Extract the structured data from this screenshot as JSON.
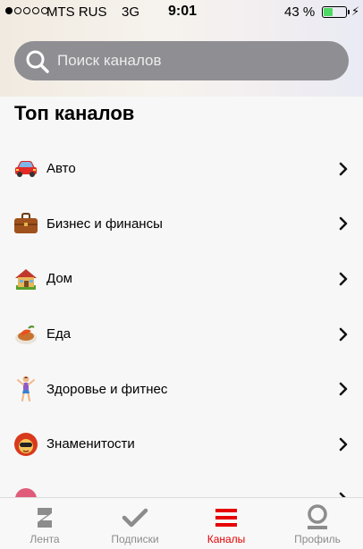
{
  "status_bar": {
    "carrier": "MTS RUS",
    "network": "3G",
    "time": "9:01",
    "battery_percent": "43 %",
    "battery_level": 0.43,
    "signal_bars": 1
  },
  "search": {
    "placeholder": "Поиск каналов"
  },
  "section": {
    "title": "Топ каналов"
  },
  "categories": [
    {
      "label": "Авто",
      "icon": "car-icon"
    },
    {
      "label": "Бизнес и финансы",
      "icon": "briefcase-icon"
    },
    {
      "label": "Дом",
      "icon": "house-icon"
    },
    {
      "label": "Еда",
      "icon": "food-icon"
    },
    {
      "label": "Здоровье и фитнес",
      "icon": "fitness-icon"
    },
    {
      "label": "Знаменитости",
      "icon": "celebrity-icon"
    }
  ],
  "tabbar": {
    "tabs": [
      {
        "label": "Лента",
        "icon": "feed-icon",
        "active": false
      },
      {
        "label": "Подписки",
        "icon": "checkmark-icon",
        "active": false
      },
      {
        "label": "Каналы",
        "icon": "menu-icon",
        "active": true
      },
      {
        "label": "Профиль",
        "icon": "profile-icon",
        "active": false
      }
    ]
  },
  "colors": {
    "accent": "#e60000",
    "search_bg": "#8e8e93",
    "battery": "#4cd964"
  }
}
